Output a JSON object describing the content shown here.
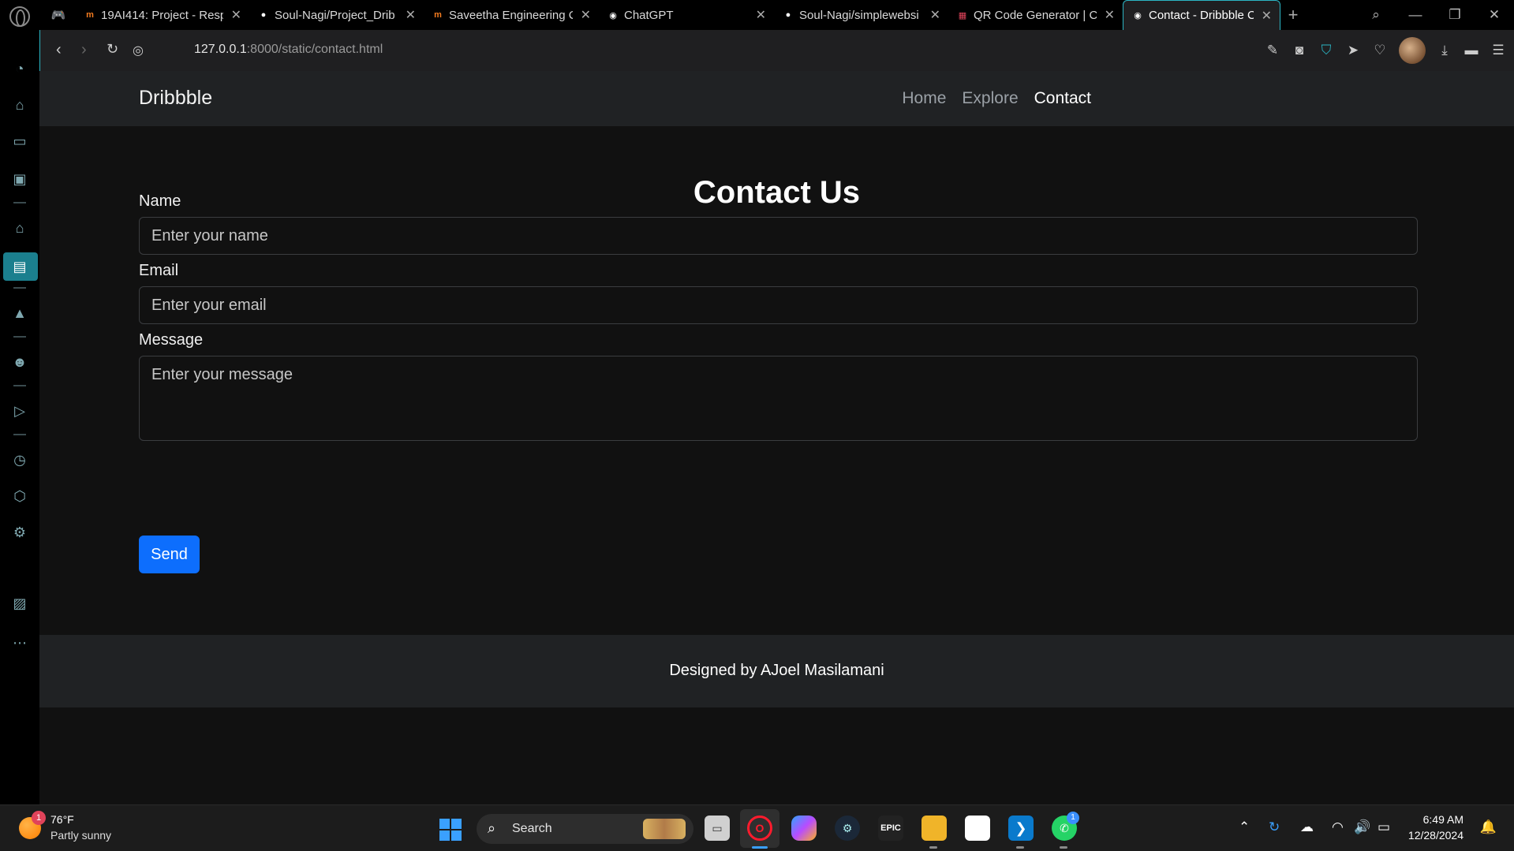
{
  "browser": {
    "tabs": [
      {
        "label": "19AI414: Project - Resp",
        "favicon": "m",
        "color": "#f47c20"
      },
      {
        "label": "Soul-Nagi/Project_Drib",
        "favicon": "gh",
        "color": "#ffffff"
      },
      {
        "label": "Saveetha Engineering C",
        "favicon": "m",
        "color": "#f47c20"
      },
      {
        "label": "ChatGPT",
        "favicon": "gpt",
        "color": "#ffffff"
      },
      {
        "label": "Soul-Nagi/simplewebsi",
        "favicon": "gh",
        "color": "#ffffff"
      },
      {
        "label": "QR Code Generator | C",
        "favicon": "qr",
        "color": "#e0435a"
      },
      {
        "label": "Contact - Dribbble Clon",
        "favicon": "globe",
        "color": "#ffffff",
        "active": true
      }
    ],
    "url": {
      "host": "127.0.0.1",
      "rest": ":8000/static/contact.html"
    },
    "accent": "#2bb5c4"
  },
  "site": {
    "brand": "Dribbble",
    "nav": [
      {
        "label": "Home",
        "active": false
      },
      {
        "label": "Explore",
        "active": false
      },
      {
        "label": "Contact",
        "active": true
      }
    ],
    "heading": "Contact Us",
    "form": {
      "name_label": "Name",
      "name_placeholder": "Enter your name",
      "email_label": "Email",
      "email_placeholder": "Enter your email",
      "message_label": "Message",
      "message_placeholder": "Enter your message",
      "send_label": "Send"
    },
    "footer": "Designed by AJoel Masilamani",
    "colors": {
      "primary_button": "#0d6efd",
      "navbar_bg": "#202224",
      "page_bg": "#111111"
    }
  },
  "taskbar": {
    "weather_temp": "76°F",
    "weather_desc": "Partly sunny",
    "weather_badge": "1",
    "search_label": "Search",
    "whatsapp_badge": "1",
    "time": "6:49 AM",
    "date": "12/28/2024"
  }
}
